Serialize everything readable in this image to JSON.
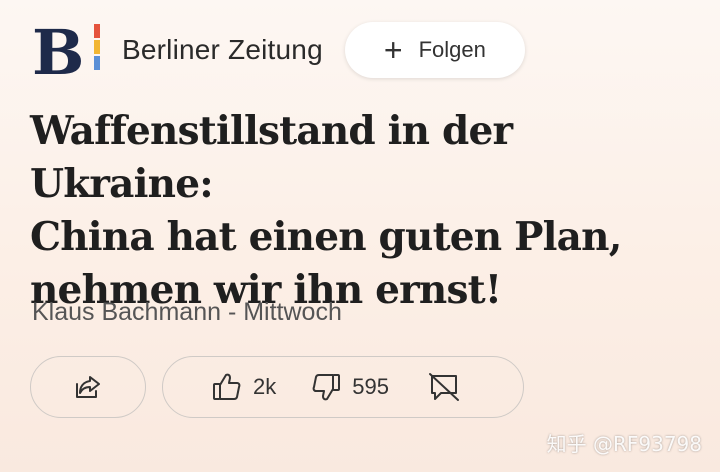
{
  "publisher": {
    "name": "Berliner Zeitung",
    "logo_letter": "B",
    "follow_label": "Folgen"
  },
  "article": {
    "headline_lines": [
      "Waffenstillstand in der Ukraine:",
      "China hat einen guten Plan,",
      "nehmen wir ihn ernst!"
    ],
    "byline": "Klaus Bachmann - Mittwoch"
  },
  "actions": {
    "likes": "2k",
    "dislikes": "595"
  },
  "watermark": "知乎 @RF93798",
  "icons": {
    "logo": "berliner-zeitung-logo",
    "follow": "plus-icon",
    "share": "share-icon",
    "like": "thumbs-up-icon",
    "dislike": "thumbs-down-icon",
    "comments_off": "comment-off-icon"
  },
  "colors": {
    "background_top": "#fdf7f3",
    "background_bottom": "#f9e9df",
    "logo_navy": "#1e2a4a",
    "logo_accent_red": "#e5533d",
    "logo_accent_yellow": "#f2b632",
    "logo_accent_blue": "#5b8fd6"
  }
}
